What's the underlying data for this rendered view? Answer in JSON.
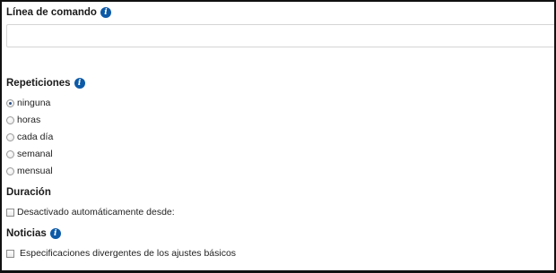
{
  "command_line": {
    "label": "Línea de comando",
    "value": "",
    "info_icon": "info-icon"
  },
  "repetitions": {
    "label": "Repeticiones",
    "info_icon": "info-icon",
    "options": [
      "ninguna",
      "horas",
      "cada día",
      "semanal",
      "mensual"
    ],
    "selected": "ninguna"
  },
  "duration": {
    "label": "Duración",
    "checkbox_label": "Desactivado automáticamente desde:",
    "checked": false
  },
  "notices": {
    "label": "Noticias",
    "info_icon": "info-icon",
    "checkbox_label": "Especificaciones divergentes de los ajustes básicos",
    "checked": false
  },
  "colors": {
    "info_icon_bg": "#0d5aa7",
    "frame_border": "#111111"
  }
}
